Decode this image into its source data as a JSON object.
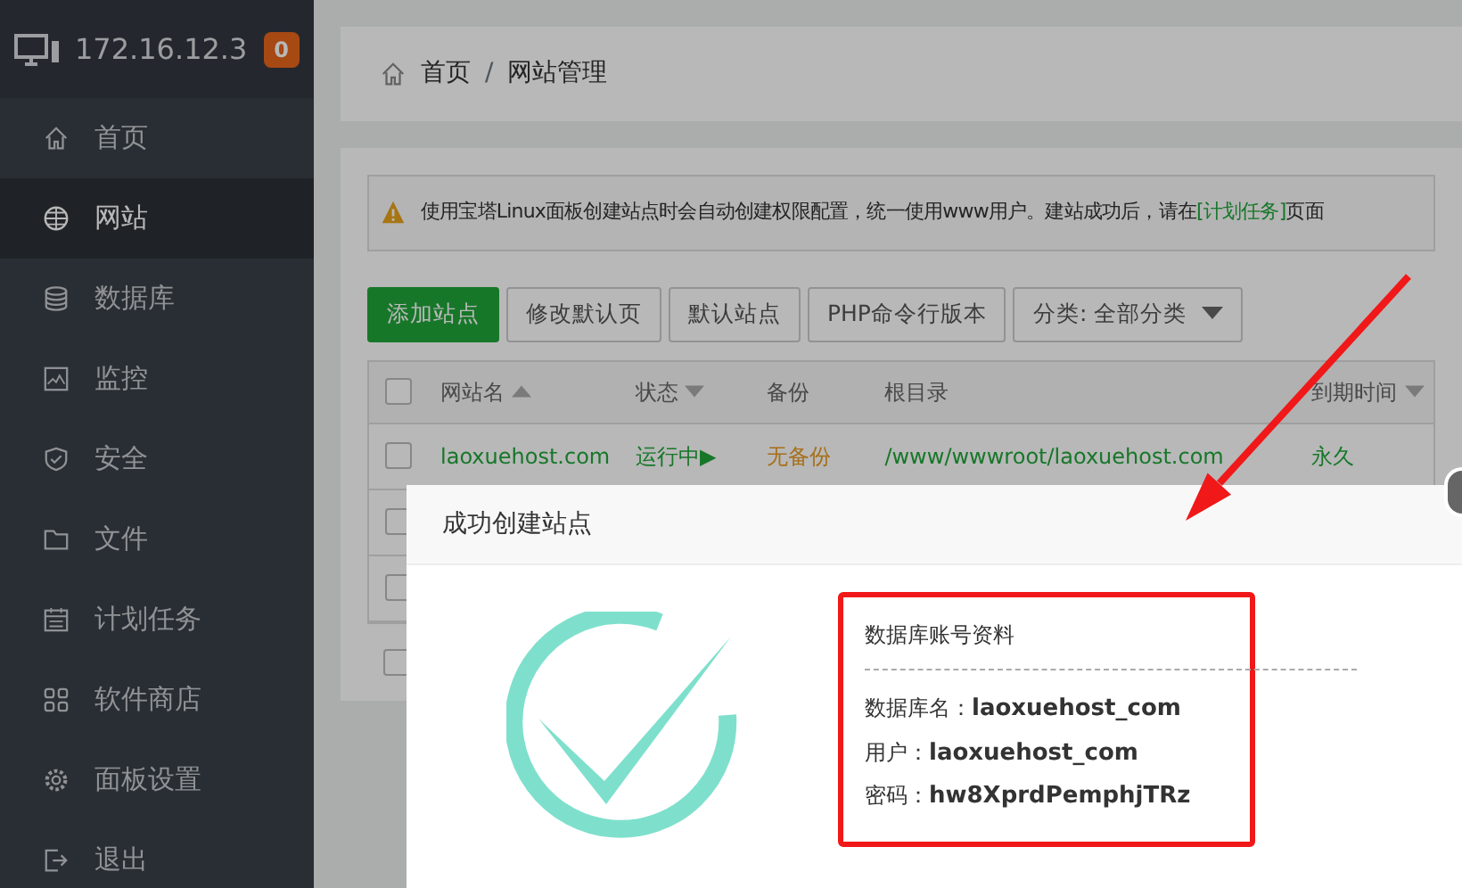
{
  "sidebar": {
    "host": "172.16.12.3",
    "badge": "0",
    "items": [
      {
        "label": "首页",
        "selected": false
      },
      {
        "label": "网站",
        "selected": true
      },
      {
        "label": "数据库",
        "selected": false
      },
      {
        "label": "监控",
        "selected": false
      },
      {
        "label": "安全",
        "selected": false
      },
      {
        "label": "文件",
        "selected": false
      },
      {
        "label": "计划任务",
        "selected": false
      },
      {
        "label": "软件商店",
        "selected": false
      },
      {
        "label": "面板设置",
        "selected": false
      },
      {
        "label": "退出",
        "selected": false
      }
    ]
  },
  "breadcrumb": {
    "items": [
      "首页",
      "网站管理"
    ],
    "separator": "/"
  },
  "notice": {
    "text": "使用宝塔Linux面板创建站点时会自动创建权限配置，统一使用www用户。建站成功后，请在",
    "link": "[计划任务]",
    "after": "页面"
  },
  "toolbar": {
    "buttons": [
      {
        "label": "添加站点",
        "kind": "primary"
      },
      {
        "label": "修改默认页",
        "kind": "default"
      },
      {
        "label": "默认站点",
        "kind": "default"
      },
      {
        "label": "PHP命令行版本",
        "kind": "default"
      }
    ],
    "dropdown": "分类: 全部分类"
  },
  "table": {
    "header_checked": false,
    "columns": [
      {
        "label": "网站名",
        "sort_arrow": true,
        "ascending": true
      },
      {
        "label": "状态",
        "sort_arrow": true,
        "ascending": false
      },
      {
        "label": "备份",
        "sort_arrow": false
      },
      {
        "label": "根目录",
        "sort_arrow": false
      },
      {
        "label": "到期时间",
        "sort_arrow": true,
        "ascending": false
      }
    ],
    "rows": [
      {
        "checked": false,
        "cells": [
          "laoxuehost.com",
          "运行中▶",
          "无备份",
          "/www/wwwroot/laoxuehost.com",
          "永久"
        ]
      },
      {
        "checked": false
      },
      {
        "checked": false
      }
    ],
    "footer_checked": false
  },
  "dialog": {
    "title": "成功创建站点",
    "info_title": "数据库账号资料",
    "fields": [
      {
        "label": "数据库名：",
        "value": "laoxuehost_com"
      },
      {
        "label": "用户：",
        "value": "laoxuehost_com"
      },
      {
        "label": "密码：",
        "value": "hw8XprdPemphjTRz"
      }
    ]
  }
}
